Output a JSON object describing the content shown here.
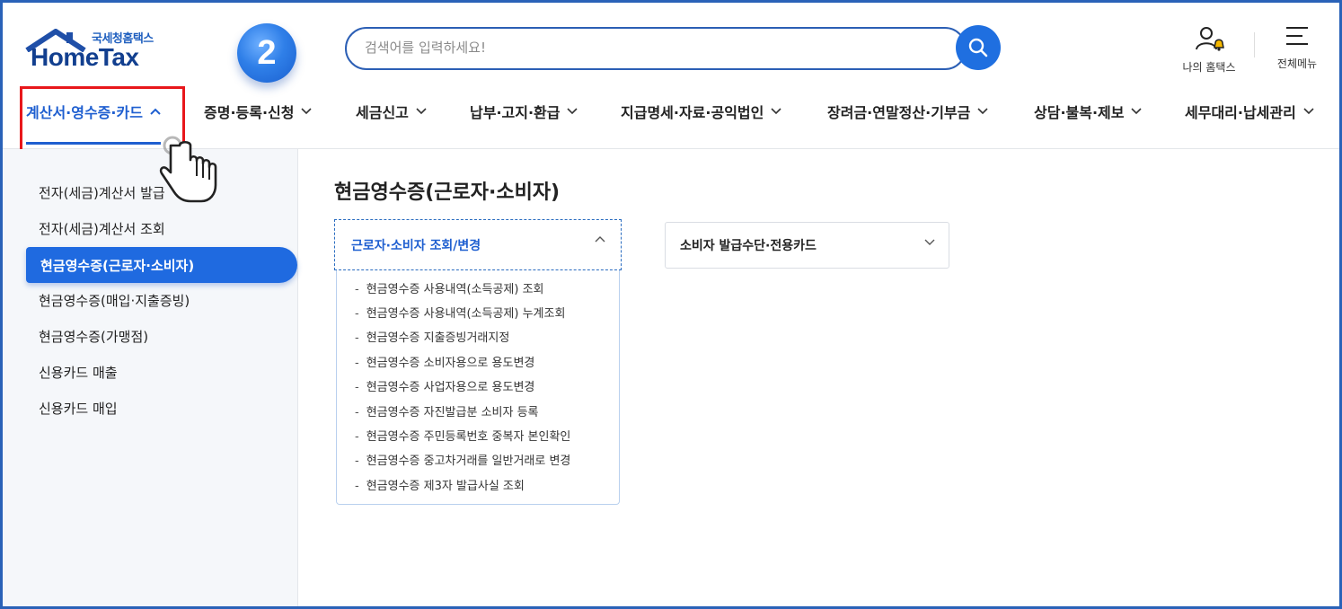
{
  "header": {
    "logo_sub": "국세청홈택스",
    "logo_main": "HomeTax",
    "step_number": "2",
    "search_placeholder": "검색어를 입력하세요!",
    "my_hometax_label": "나의 홈택스",
    "all_menu_label": "전체메뉴"
  },
  "nav": {
    "items": [
      {
        "label": "계산서·영수증·카드",
        "active": true
      },
      {
        "label": "증명·등록·신청"
      },
      {
        "label": "세금신고"
      },
      {
        "label": "납부·고지·환급"
      },
      {
        "label": "지급명세·자료·공익법인"
      },
      {
        "label": "장려금·연말정산·기부금"
      },
      {
        "label": "상담·불복·제보"
      },
      {
        "label": "세무대리·납세관리"
      }
    ]
  },
  "sidebar": {
    "items": [
      {
        "label": "전자(세금)계산서 발급"
      },
      {
        "label": "전자(세금)계산서 조회"
      },
      {
        "label": "현금영수증(근로자·소비자)",
        "active": true
      },
      {
        "label": "현금영수증(매입·지출증빙)"
      },
      {
        "label": "현금영수증(가맹점)"
      },
      {
        "label": "신용카드 매출"
      },
      {
        "label": "신용카드 매입"
      }
    ]
  },
  "main": {
    "title": "현금영수증(근로자·소비자)",
    "accordion1": {
      "title": "근로자·소비자 조회/변경",
      "items": [
        "현금영수증 사용내역(소득공제) 조회",
        "현금영수증 사용내역(소득공제) 누계조회",
        "현금영수증 지출증빙거래지정",
        "현금영수증 소비자용으로 용도변경",
        "현금영수증 사업자용으로 용도변경",
        "현금영수증 자진발급분 소비자 등록",
        "현금영수증 주민등록번호 중복자 본인확인",
        "현금영수증 중고차거래를 일반거래로 변경",
        "현금영수증 제3자 발급사실 조회"
      ]
    },
    "accordion2": {
      "title": "소비자 발급수단·전용카드"
    }
  },
  "colors": {
    "accent": "#1f6ae0",
    "highlight": "#e8171b",
    "frame": "#2a62b8"
  }
}
